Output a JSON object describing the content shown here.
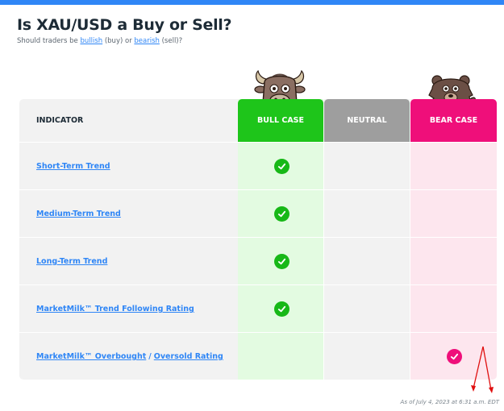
{
  "page": {
    "title": "Is XAU/USD a Buy or Sell?",
    "subtitle_pre": "Should traders be ",
    "subtitle_bullish": "bullish",
    "subtitle_mid1": " (buy) or ",
    "subtitle_bearish": "bearish",
    "subtitle_post": " (sell)?"
  },
  "table": {
    "headers": {
      "indicator": "INDICATOR",
      "bull": "BULL CASE",
      "neutral": "NEUTRAL",
      "bear": "BEAR CASE"
    },
    "rows": [
      {
        "label": "Short-Term Trend",
        "signal": "bull"
      },
      {
        "label": "Medium-Term Trend",
        "signal": "bull"
      },
      {
        "label": "Long-Term Trend",
        "signal": "bull"
      },
      {
        "label": "MarketMilk™ Trend Following Rating",
        "signal": "bull"
      },
      {
        "label_a": "MarketMilk™ Overbought",
        "label_sep": "/",
        "label_b": "Oversold Rating",
        "signal": "bear"
      }
    ]
  },
  "mascots": {
    "bull": "bull-mascot-icon",
    "bear": "bear-mascot-icon"
  },
  "icons": {
    "check": "check-circle-icon"
  },
  "footer": {
    "timestamp": "As of July 4, 2023 at 6:31 a.m. EDT"
  },
  "colors": {
    "accent_blue": "#2f86f6",
    "bull_green": "#1ec51a",
    "neutral_gray": "#9e9e9e",
    "bear_pink": "#ef0f7a"
  }
}
